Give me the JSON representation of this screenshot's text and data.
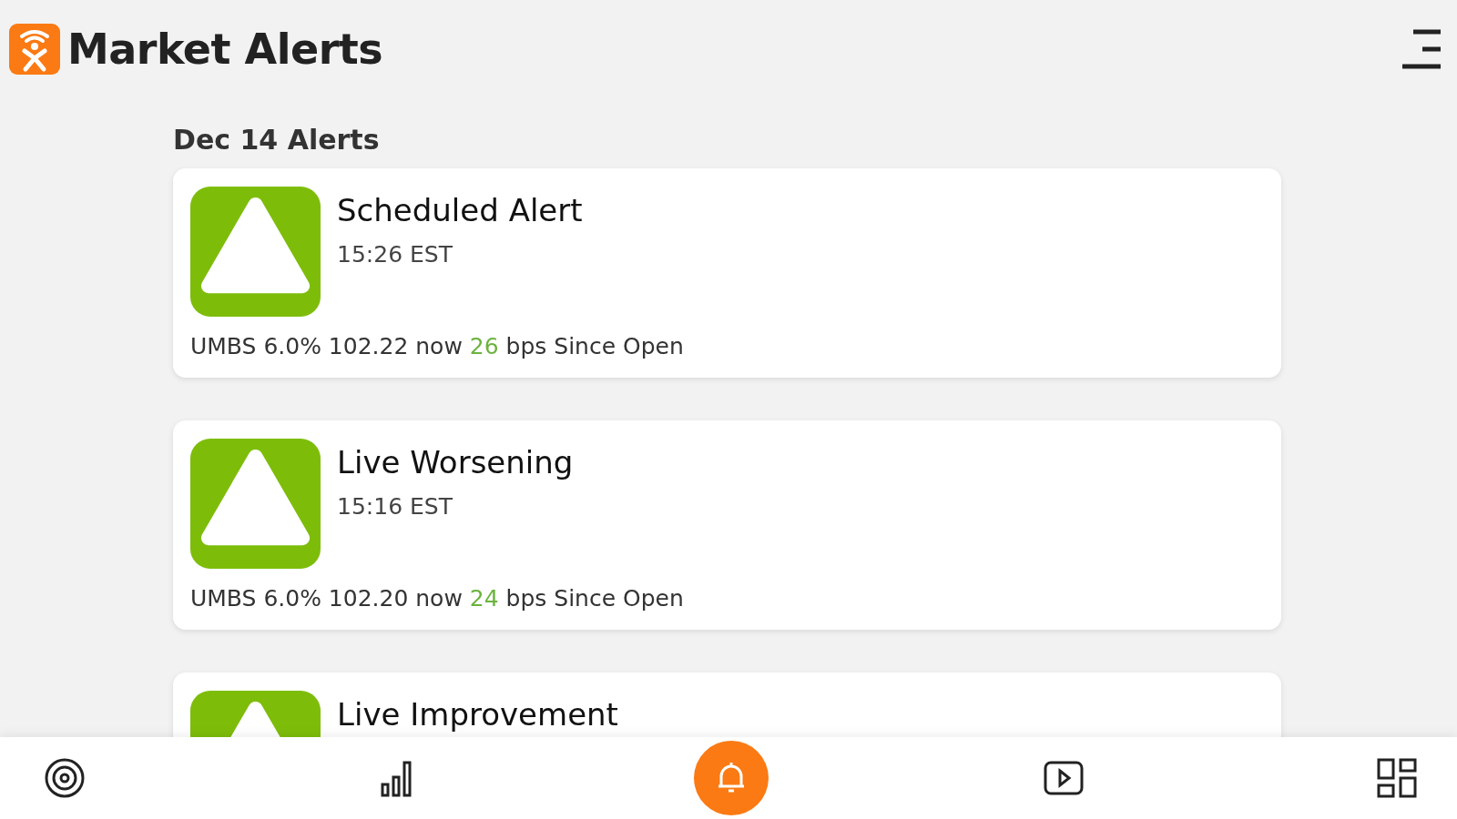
{
  "app": {
    "title": "Market Alerts"
  },
  "section": {
    "heading": "Dec 14 Alerts"
  },
  "alerts": [
    {
      "title": "Scheduled Alert",
      "time": "15:26 EST",
      "text_before": "UMBS 6.0% 102.22 now",
      "change": "26",
      "text_after": "bps Since Open"
    },
    {
      "title": "Live Worsening",
      "time": "15:16 EST",
      "text_before": "UMBS 6.0% 102.20 now",
      "change": "24",
      "text_after": "bps Since Open"
    },
    {
      "title": "Live Improvement"
    }
  ],
  "nav": [
    {
      "kind": "target",
      "selected": false
    },
    {
      "kind": "chart",
      "selected": false
    },
    {
      "kind": "bell",
      "selected": true
    },
    {
      "kind": "video",
      "selected": false
    },
    {
      "kind": "grid",
      "selected": false
    }
  ]
}
